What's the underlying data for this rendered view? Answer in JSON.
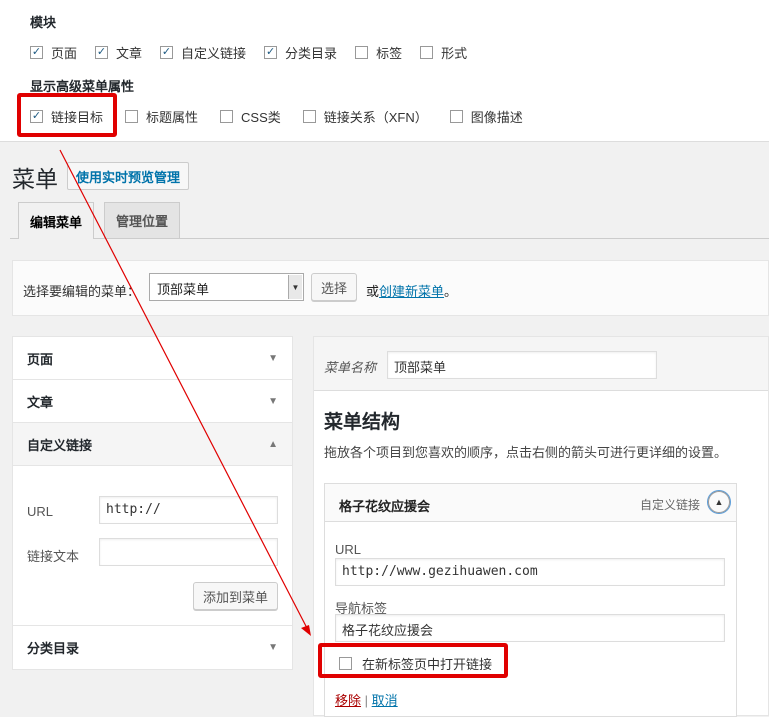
{
  "screen_options": {
    "modules_heading": "模块",
    "modules": [
      {
        "label": "页面",
        "checked": true
      },
      {
        "label": "文章",
        "checked": true
      },
      {
        "label": "自定义链接",
        "checked": true
      },
      {
        "label": "分类目录",
        "checked": true
      },
      {
        "label": "标签",
        "checked": false
      },
      {
        "label": "形式",
        "checked": false
      }
    ],
    "advanced_heading": "显示高级菜单属性",
    "advanced": [
      {
        "label": "链接目标",
        "checked": true
      },
      {
        "label": "标题属性",
        "checked": false
      },
      {
        "label": "CSS类",
        "checked": false
      },
      {
        "label": "链接关系（XFN）",
        "checked": false
      },
      {
        "label": "图像描述",
        "checked": false
      }
    ]
  },
  "page": {
    "title": "菜单",
    "live_preview_button": "使用实时预览管理"
  },
  "tabs": [
    {
      "label": "编辑菜单",
      "active": true
    },
    {
      "label": "管理位置",
      "active": false
    }
  ],
  "select_menu": {
    "label": "选择要编辑的菜单：",
    "selected": "顶部菜单",
    "select_button": "选择",
    "or_text": "或",
    "create_link": "创建新菜单",
    "period": "。"
  },
  "accordion": {
    "sections": [
      "页面",
      "文章",
      "自定义链接",
      "分类目录"
    ],
    "custom_link": {
      "url_label": "URL",
      "url_value": "http://",
      "text_label": "链接文本",
      "text_value": "",
      "add_button": "添加到菜单"
    }
  },
  "menu_editor": {
    "name_label": "菜单名称",
    "name_value": "顶部菜单",
    "structure_title": "菜单结构",
    "structure_desc": "拖放各个项目到您喜欢的顺序，点击右侧的箭头可进行更详细的设置。",
    "item": {
      "title": "格子花纹应援会",
      "type": "自定义链接",
      "url_label": "URL",
      "url_value": "http://www.gezihuawen.com",
      "nav_label": "导航标签",
      "nav_value": "格子花纹应援会",
      "new_tab_label": "在新标签页中打开链接",
      "new_tab_checked": false,
      "remove_link": "移除",
      "separator": "|",
      "cancel_link": "取消"
    }
  },
  "colors": {
    "annotation_red": "#e00000",
    "link_blue": "#0073aa",
    "remove_red": "#a00"
  }
}
